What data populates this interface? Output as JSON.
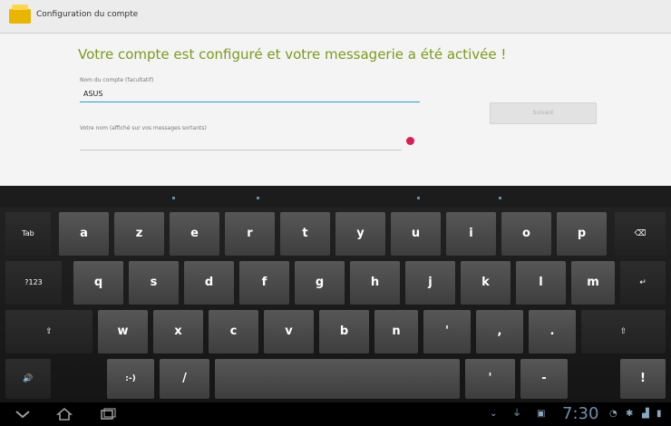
{
  "titlebar": {
    "title": "Configuration du compte",
    "app_icon": "folder-envelope-icon"
  },
  "content": {
    "heading": "Votre compte est configuré et votre messagerie a été activée !",
    "account_name": {
      "label": "Nom du compte (facultatif)",
      "value": "ASUS"
    },
    "display_name": {
      "label": "Votre nom (affiché sur vos messages sortants)",
      "value": ""
    },
    "next_button": "Suivant"
  },
  "keyboard": {
    "row1": [
      "Tab",
      "a",
      "z",
      "e",
      "r",
      "t",
      "y",
      "u",
      "i",
      "o",
      "p",
      "⌫"
    ],
    "row2": [
      "?123",
      "q",
      "s",
      "d",
      "f",
      "g",
      "h",
      "j",
      "k",
      "l",
      "m",
      "↵"
    ],
    "row3": [
      "⇧",
      "w",
      "x",
      "c",
      "v",
      "b",
      "n",
      "'",
      ",",
      ".",
      "⇧"
    ],
    "row4": [
      "🔊",
      ":-)",
      "/",
      "",
      "'",
      "-",
      "!"
    ]
  },
  "statusbar": {
    "time": "7:30",
    "nav_icons": [
      "back-icon",
      "home-icon",
      "recent-apps-icon"
    ]
  },
  "colors": {
    "accent_green": "#7d9a1e",
    "accent_blue": "#2a9ad6",
    "error_red": "#d62052"
  }
}
